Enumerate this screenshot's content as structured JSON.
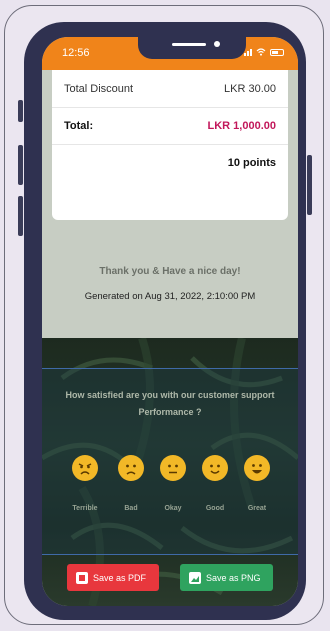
{
  "status_bar": {
    "time": "12:56"
  },
  "receipt": {
    "total_discount_label": "Total Discount",
    "total_discount_value": "LKR 30.00",
    "total_label": "Total:",
    "total_value": "LKR 1,000.00",
    "points": "10 points",
    "thanks": "Thank you & Have a nice day!",
    "generated": "Generated on Aug 31, 2022, 2:10:00 PM"
  },
  "survey": {
    "question": "How satisfied are you with our customer support Performance ?",
    "options": [
      {
        "label": "Terrible",
        "icon": "angry-face-icon"
      },
      {
        "label": "Bad",
        "icon": "sad-face-icon"
      },
      {
        "label": "Okay",
        "icon": "neutral-face-icon"
      },
      {
        "label": "Good",
        "icon": "smiling-face-icon"
      },
      {
        "label": "Great",
        "icon": "grinning-face-icon"
      }
    ]
  },
  "actions": {
    "save_pdf": "Save as PDF",
    "save_png": "Save as PNG"
  },
  "colors": {
    "status_bar": "#f0841a",
    "total_value": "#c2185b",
    "pdf_button": "#e8373d",
    "png_button": "#2fa35f",
    "emoji": "#f2b827"
  }
}
